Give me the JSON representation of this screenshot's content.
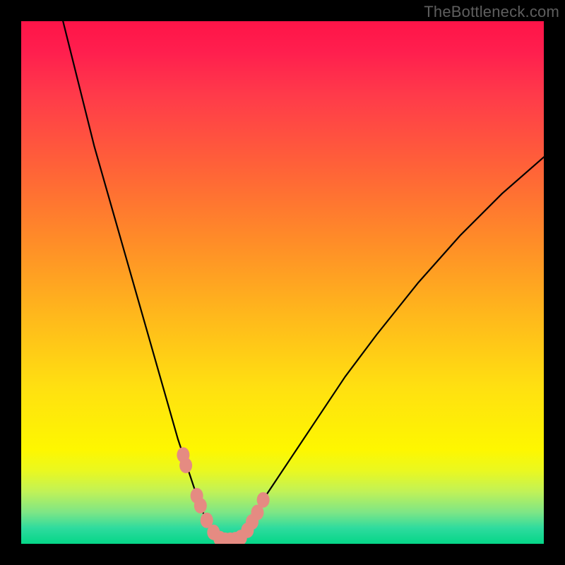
{
  "watermark": "TheBottleneck.com",
  "colors": {
    "frame_bg": "#000000",
    "curve_stroke": "#000000",
    "marker_fill": "#e58b82",
    "gradient_top": "#ff1448",
    "gradient_bottom": "#05d688"
  },
  "chart_data": {
    "type": "line",
    "title": "",
    "xlabel": "",
    "ylabel": "",
    "xlim": [
      0,
      100
    ],
    "ylim": [
      0,
      100
    ],
    "grid": false,
    "legend": "none",
    "x": [
      8,
      10,
      12,
      14,
      16,
      18,
      20,
      22,
      24,
      26,
      28,
      30,
      31,
      32,
      33,
      34,
      35,
      36,
      37,
      38,
      39,
      40,
      41,
      42,
      43,
      44,
      46,
      48,
      52,
      56,
      62,
      68,
      76,
      84,
      92,
      100
    ],
    "y": [
      100,
      92,
      84,
      76,
      69,
      62,
      55,
      48,
      41,
      34,
      27,
      20,
      17,
      14,
      11,
      8,
      5.5,
      3.2,
      1.8,
      1.0,
      0.7,
      0.7,
      0.9,
      1.6,
      3.0,
      4.8,
      8,
      11,
      17,
      23,
      32,
      40,
      50,
      59,
      67,
      74
    ],
    "annotations": [],
    "markers": {
      "x": [
        31,
        31.5,
        33.6,
        34.3,
        35.5,
        36.8,
        38.0,
        39.0,
        40.0,
        41.0,
        42.0,
        43.3,
        44.2,
        45.2,
        46.3
      ],
      "y": [
        17,
        15,
        9.2,
        7.3,
        4.5,
        2.2,
        1.0,
        0.7,
        0.7,
        0.8,
        1.2,
        2.6,
        4.2,
        6.0,
        8.4
      ]
    }
  }
}
